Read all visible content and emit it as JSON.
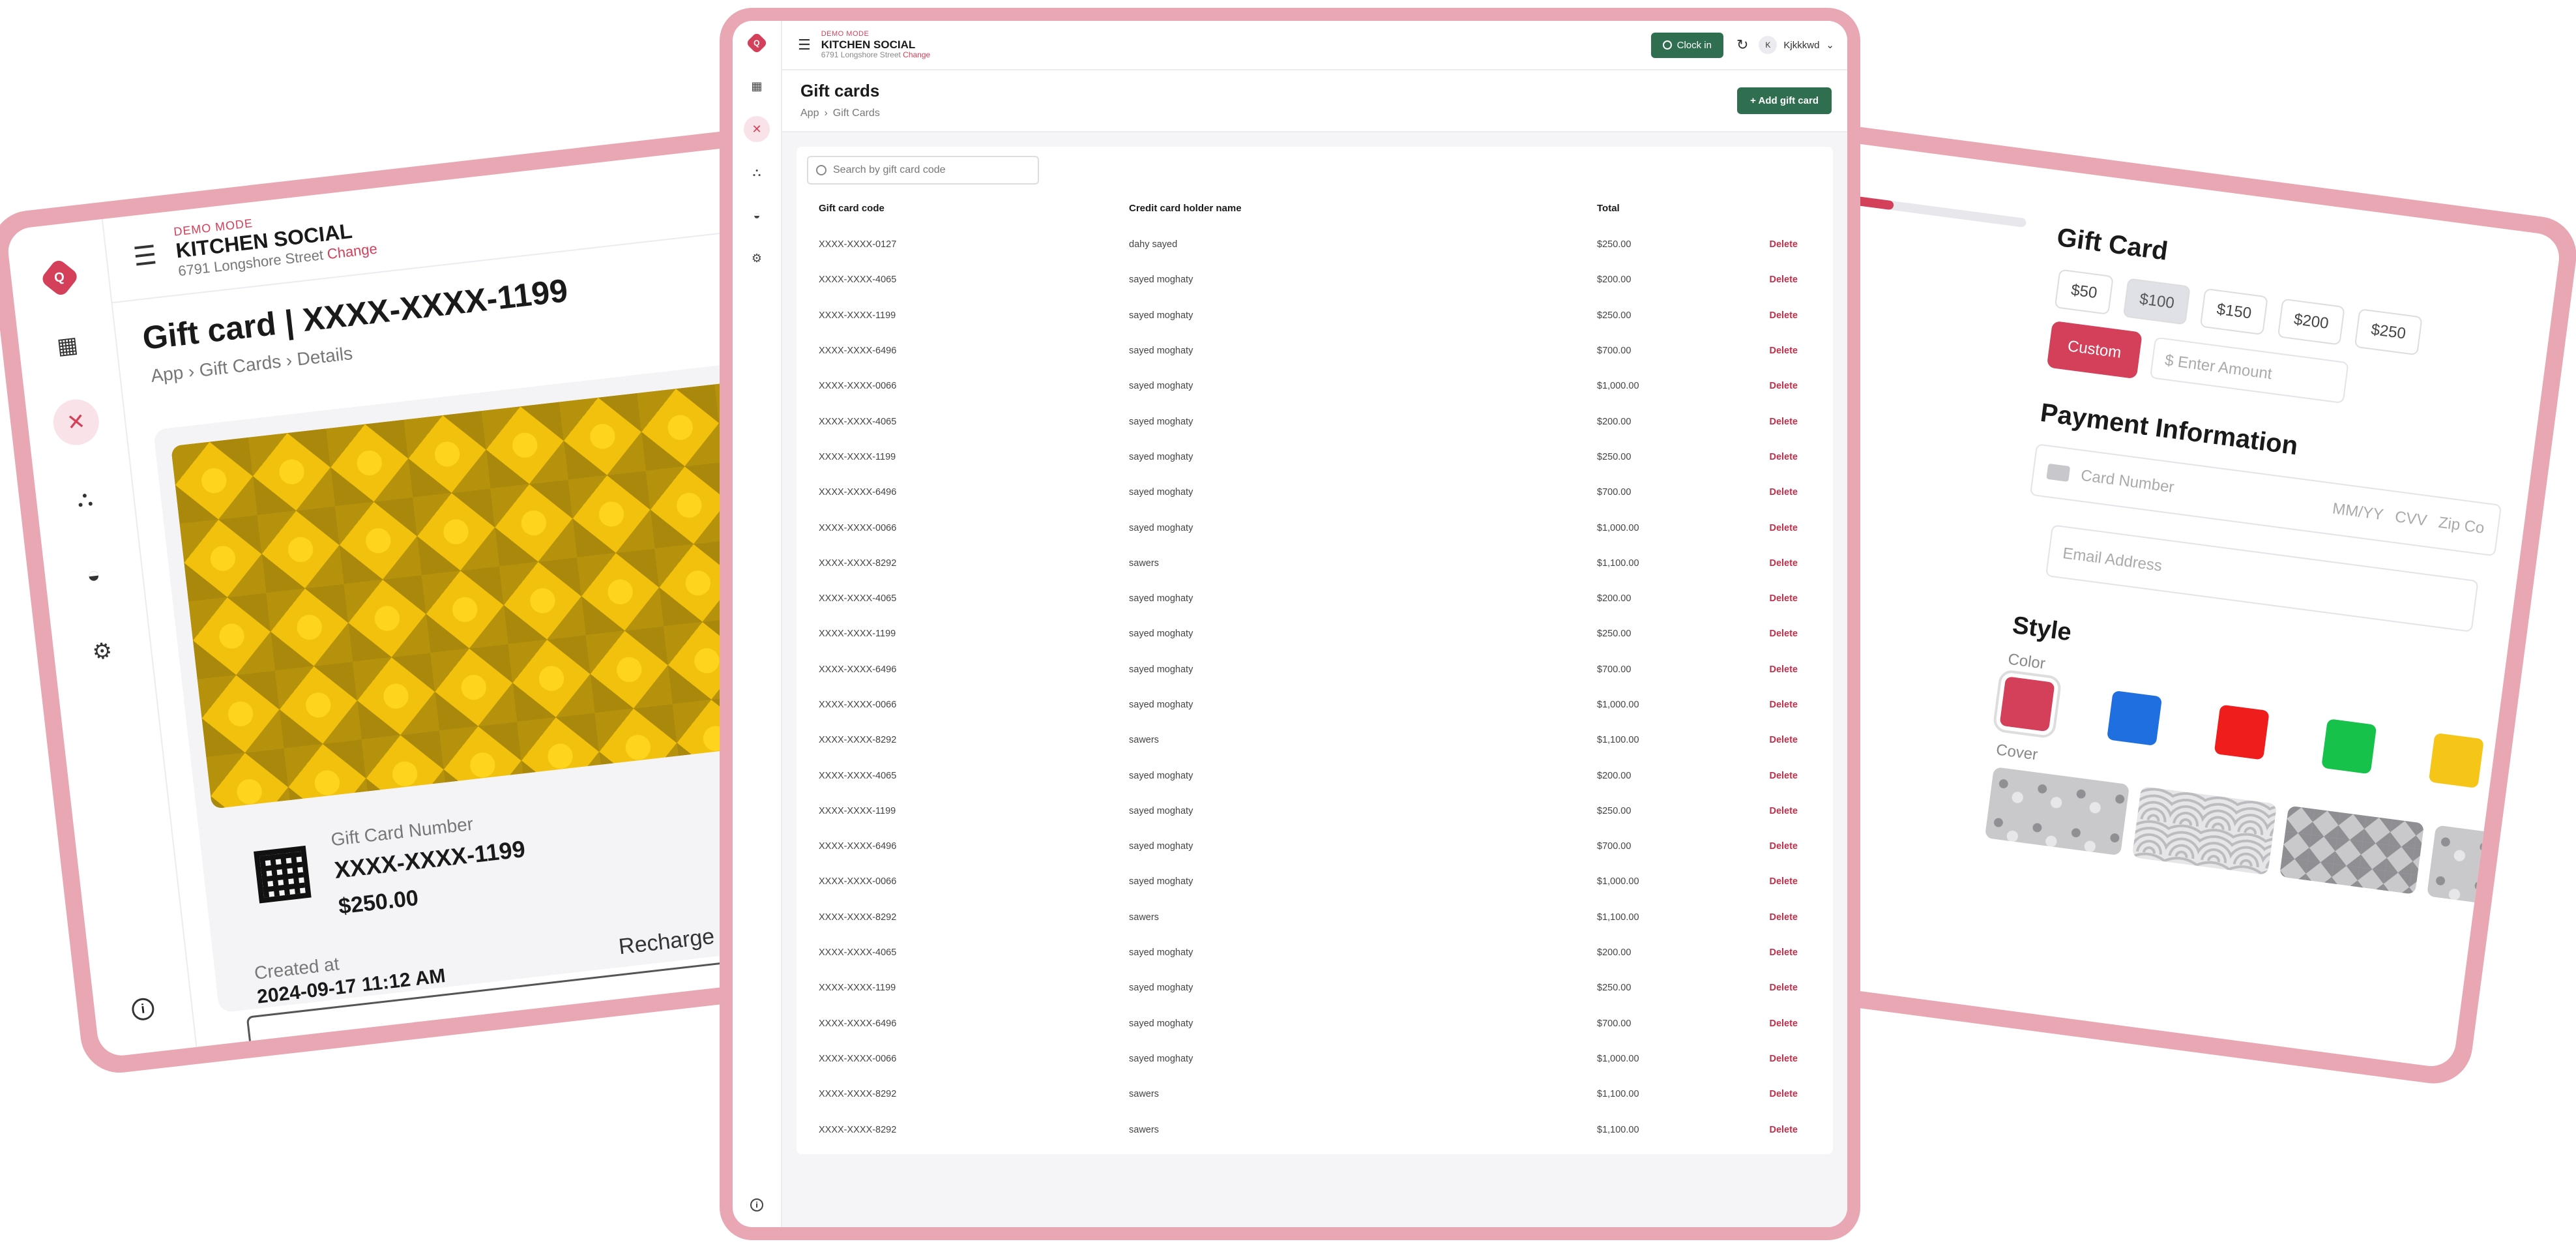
{
  "left_panel": {
    "demo_label": "DEMO MODE",
    "brand": "KITCHEN SOCIAL",
    "address": "6791 Longshore Street",
    "change_link": "Change",
    "title": "Gift card | XXXX-XXXX-1199",
    "breadcrumb": [
      "App",
      "Gift Cards",
      "Details"
    ],
    "gift_card_number_label": "Gift Card Number",
    "gift_card_number": "XXXX-XXXX-1199",
    "amount": "$250.00",
    "created_label": "Created at",
    "created_value": "2024-09-17 11:12 AM",
    "recharge_label": "Recharge",
    "card_color": "#f1c10d"
  },
  "center_panel": {
    "logo_letter": "Q",
    "demo_label": "DEMO MODE",
    "brand": "KITCHEN SOCIAL",
    "address": "6791 Longshore Street",
    "change_link": "Change",
    "clock_in_label": "Clock in",
    "user_initial": "K",
    "user_name": "Kjkkkwd",
    "page_title": "Gift cards",
    "breadcrumb": [
      "App",
      "Gift Cards"
    ],
    "add_button_label": "+ Add gift card",
    "search_placeholder": "Search by gift card code",
    "table": {
      "headers": [
        "Gift card code",
        "Credit card holder name",
        "Total"
      ],
      "delete_label": "Delete",
      "rows": [
        {
          "code": "XXXX-XXXX-0127",
          "name": "dahy sayed",
          "total": "$250.00"
        },
        {
          "code": "XXXX-XXXX-4065",
          "name": "sayed moghaty",
          "total": "$200.00"
        },
        {
          "code": "XXXX-XXXX-1199",
          "name": "sayed moghaty",
          "total": "$250.00"
        },
        {
          "code": "XXXX-XXXX-6496",
          "name": "sayed moghaty",
          "total": "$700.00"
        },
        {
          "code": "XXXX-XXXX-0066",
          "name": "sayed moghaty",
          "total": "$1,000.00"
        },
        {
          "code": "XXXX-XXXX-4065",
          "name": "sayed moghaty",
          "total": "$200.00"
        },
        {
          "code": "XXXX-XXXX-1199",
          "name": "sayed moghaty",
          "total": "$250.00"
        },
        {
          "code": "XXXX-XXXX-6496",
          "name": "sayed moghaty",
          "total": "$700.00"
        },
        {
          "code": "XXXX-XXXX-0066",
          "name": "sayed moghaty",
          "total": "$1,000.00"
        },
        {
          "code": "XXXX-XXXX-8292",
          "name": "sawers",
          "total": "$1,100.00"
        },
        {
          "code": "XXXX-XXXX-4065",
          "name": "sayed moghaty",
          "total": "$200.00"
        },
        {
          "code": "XXXX-XXXX-1199",
          "name": "sayed moghaty",
          "total": "$250.00"
        },
        {
          "code": "XXXX-XXXX-6496",
          "name": "sayed moghaty",
          "total": "$700.00"
        },
        {
          "code": "XXXX-XXXX-0066",
          "name": "sayed moghaty",
          "total": "$1,000.00"
        },
        {
          "code": "XXXX-XXXX-8292",
          "name": "sawers",
          "total": "$1,100.00"
        },
        {
          "code": "XXXX-XXXX-4065",
          "name": "sayed moghaty",
          "total": "$200.00"
        },
        {
          "code": "XXXX-XXXX-1199",
          "name": "sayed moghaty",
          "total": "$250.00"
        },
        {
          "code": "XXXX-XXXX-6496",
          "name": "sayed moghaty",
          "total": "$700.00"
        },
        {
          "code": "XXXX-XXXX-0066",
          "name": "sayed moghaty",
          "total": "$1,000.00"
        },
        {
          "code": "XXXX-XXXX-8292",
          "name": "sawers",
          "total": "$1,100.00"
        },
        {
          "code": "XXXX-XXXX-4065",
          "name": "sayed moghaty",
          "total": "$200.00"
        },
        {
          "code": "XXXX-XXXX-1199",
          "name": "sayed moghaty",
          "total": "$250.00"
        },
        {
          "code": "XXXX-XXXX-6496",
          "name": "sayed moghaty",
          "total": "$700.00"
        },
        {
          "code": "XXXX-XXXX-0066",
          "name": "sayed moghaty",
          "total": "$1,000.00"
        },
        {
          "code": "XXXX-XXXX-8292",
          "name": "sawers",
          "total": "$1,100.00"
        },
        {
          "code": "XXXX-XXXX-8292",
          "name": "sawers",
          "total": "$1,100.00"
        }
      ]
    }
  },
  "right_panel": {
    "title": "Gift Card",
    "amounts": [
      "$50",
      "$100",
      "$150",
      "$200",
      "$250"
    ],
    "selected_amount": "$100",
    "custom_label": "Custom",
    "amount_placeholder": "$ Enter Amount",
    "payment_title": "Payment Information",
    "card_number_placeholder": "Card Number",
    "expiry_placeholder": "MM/YY",
    "cvv_placeholder": "CVV",
    "zip_placeholder": "Zip Co",
    "email_placeholder": "Email Address",
    "style_title": "Style",
    "color_label": "Color",
    "colors": [
      "#d4405a",
      "#1f6fe0",
      "#f01d1d",
      "#16c24a",
      "#f5c518"
    ],
    "cover_label": "Cover"
  },
  "theme": {
    "frame": "#e8a7b2",
    "accent": "#d4405a",
    "primary_button": "#2f6f4f"
  }
}
